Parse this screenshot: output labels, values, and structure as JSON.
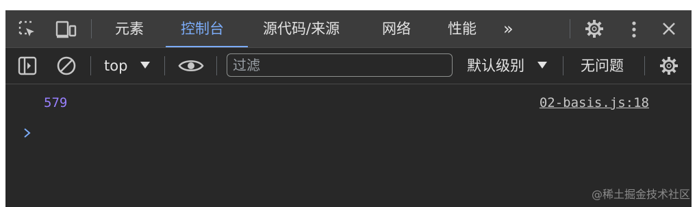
{
  "tabs": {
    "items": [
      "元素",
      "控制台",
      "源代码/来源",
      "网络",
      "性能"
    ],
    "more": "»"
  },
  "toolbar": {
    "context": "top",
    "filter_placeholder": "过滤",
    "levels": "默认级别",
    "issues": "无问题"
  },
  "console": {
    "message_value": "579",
    "message_source": "02-basis.js:18"
  },
  "watermark": "@稀土掘金技术社区",
  "colors": {
    "panel_bg": "#282828",
    "tabbar_bg": "#3c3c3c",
    "accent": "#7cacf8",
    "number": "#9980ff"
  }
}
